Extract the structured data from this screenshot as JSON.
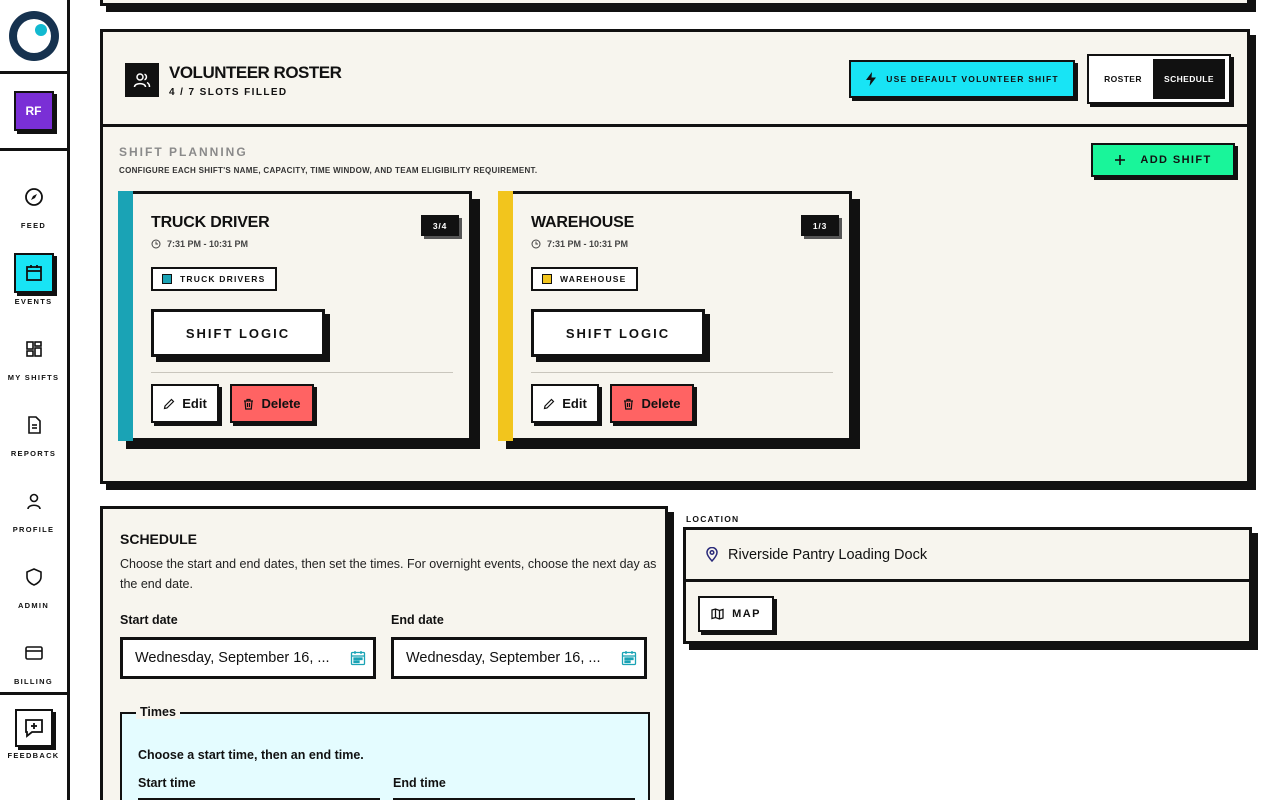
{
  "sidebar": {
    "avatar_initials": "RF",
    "items": [
      {
        "label": "FEED",
        "icon": "compass-icon",
        "active": false
      },
      {
        "label": "EVENTS",
        "icon": "calendar-icon",
        "active": true
      },
      {
        "label": "MY SHIFTS",
        "icon": "grid-icon",
        "active": false
      },
      {
        "label": "REPORTS",
        "icon": "document-icon",
        "active": false
      },
      {
        "label": "PROFILE",
        "icon": "user-icon",
        "active": false
      },
      {
        "label": "ADMIN",
        "icon": "shield-icon",
        "active": false
      },
      {
        "label": "BILLING",
        "icon": "credit-card-icon",
        "active": false
      }
    ],
    "feedback_label": "FEEDBACK"
  },
  "roster": {
    "title": "VOLUNTEER ROSTER",
    "subtitle": "4 / 7 SLOTS FILLED",
    "default_shift_button": "USE DEFAULT VOLUNTEER SHIFT",
    "view_toggle": {
      "roster": "ROSTER",
      "schedule": "SCHEDULE",
      "selected": "SCHEDULE"
    }
  },
  "shift_planning": {
    "title": "SHIFT PLANNING",
    "description": "CONFIGURE EACH SHIFT'S NAME, CAPACITY, TIME WINDOW, AND TEAM ELIGIBILITY REQUIREMENT.",
    "add_button": "ADD SHIFT",
    "shifts": [
      {
        "name": "TRUCK DRIVER",
        "time": "7:31 PM - 10:31 PM",
        "count": "3/4",
        "team": "TRUCK DRIVERS",
        "color": "#1aa3b5",
        "logic_button": "SHIFT LOGIC",
        "edit": "Edit",
        "delete": "Delete"
      },
      {
        "name": "WAREHOUSE",
        "time": "7:31 PM - 10:31 PM",
        "count": "1/3",
        "team": "WAREHOUSE",
        "color": "#f2c51d",
        "logic_button": "SHIFT LOGIC",
        "edit": "Edit",
        "delete": "Delete"
      }
    ]
  },
  "schedule": {
    "title": "SCHEDULE",
    "description": "Choose the start and end dates, then set the times. For overnight events, choose the next day as the end date.",
    "start_date_label": "Start date",
    "start_date_value": "Wednesday, September 16, ...",
    "end_date_label": "End date",
    "end_date_value": "Wednesday, September 16, ...",
    "times": {
      "legend": "Times",
      "description": "Choose a start time, then an end time.",
      "start_label": "Start time",
      "end_label": "End time"
    }
  },
  "location": {
    "label": "LOCATION",
    "value": "Riverside Pantry Loading Dock",
    "map_button": "MAP"
  },
  "colors": {
    "accent_cyan": "#18e4f5",
    "accent_green": "#19f59a",
    "delete_red": "#ff6363",
    "avatar_purple": "#7a2fd6",
    "panel_bg": "#f7f5ee"
  }
}
